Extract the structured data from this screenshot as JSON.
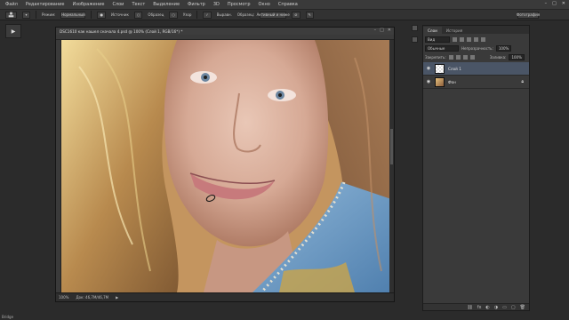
{
  "menu": [
    "Файл",
    "Редактирование",
    "Изображение",
    "Слои",
    "Текст",
    "Выделение",
    "Фильтр",
    "3D",
    "Просмотр",
    "Окно",
    "Справка"
  ],
  "window_controls": [
    "–",
    "□",
    "✕"
  ],
  "options": {
    "mode_label": "Режим:",
    "mode_value": "Нормальный",
    "source_label": "Источник",
    "sample_label": "Образец",
    "pattern_label": "Узор",
    "aligned_label": "Выравн.",
    "sample_all_label": "Образец:",
    "sample_value": "Активный и ниже",
    "workspace_value": "Фотография"
  },
  "document": {
    "tab_title": "DSC1610 как нашел сначала 4.psd @ 100% (Слой 1, RGB/16*) *",
    "zoom": "100%",
    "doc_size": "Док: 46,7M/46,7M"
  },
  "panel": {
    "tabs": [
      "Слои",
      "История"
    ],
    "kind_value": "Вид",
    "blend_value": "Обычные",
    "opacity_label": "Непрозрачность:",
    "opacity_value": "100%",
    "lock_label": "Закрепить:",
    "fill_label": "Заливка:",
    "fill_value": "100%",
    "layers": [
      {
        "name": "Слой 1",
        "selected": true
      },
      {
        "name": "Фон",
        "selected": false
      }
    ]
  },
  "app_status": "Bridge"
}
